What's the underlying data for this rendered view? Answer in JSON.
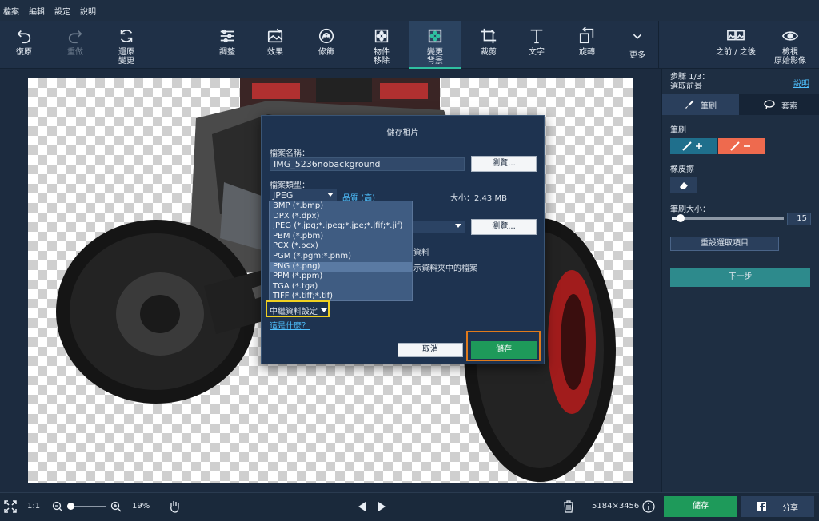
{
  "menu": [
    "檔案",
    "編輯",
    "設定",
    "說明"
  ],
  "toolbar": {
    "undo": "復原",
    "redo": "重做",
    "revert_l1": "還原",
    "revert_l2": "變更",
    "adjust": "調整",
    "effects": "效果",
    "retouch": "修飾",
    "obj_l1": "物件",
    "obj_l2": "移除",
    "bg_l1": "變更",
    "bg_l2": "背景",
    "crop": "裁剪",
    "text": "文字",
    "rotate": "旋轉",
    "more": "更多",
    "beforeafter": "之前 / 之後",
    "view_l1": "檢視",
    "view_l2": "原始影像"
  },
  "panel": {
    "step": "步驟 1/3：",
    "step_desc": "選取前景",
    "help": "說明",
    "tab_brush": "筆刷",
    "tab_lasso": "套索",
    "brush_label": "筆刷",
    "eraser_label": "橡皮擦",
    "size_label": "筆刷大小：",
    "size_value": "15",
    "reset": "重設選取項目",
    "next": "下一步"
  },
  "dialog": {
    "title": "儲存相片",
    "filename_label": "檔案名稱：",
    "filename": "IMG_5236nobackground",
    "browse": "瀏覽...",
    "filetype_label": "檔案類型：",
    "filetype": "JPEG",
    "quality": "品質 (高)",
    "size": "大小：2.43 MB",
    "browse2": "瀏覽...",
    "partial1": "資料",
    "partial2": "示資料夾中的檔案",
    "meta": "中繼資料設定",
    "whatis": "這是什麼？",
    "cancel": "取消",
    "save": "儲存",
    "formats": [
      "BMP (*.bmp)",
      "DPX (*.dpx)",
      "JPEG (*.jpg;*.jpeg;*.jpe;*.jfif;*.jif)",
      "PBM (*.pbm)",
      "PCX (*.pcx)",
      "PGM (*.pgm;*.pnm)",
      "PNG (*.png)",
      "PPM (*.ppm)",
      "TGA (*.tga)",
      "TIFF (*.tiff;*.tif)"
    ]
  },
  "status": {
    "fit": "1:1",
    "zoom": "19%",
    "dims": "5184×3456",
    "save": "儲存",
    "share": "分享"
  }
}
